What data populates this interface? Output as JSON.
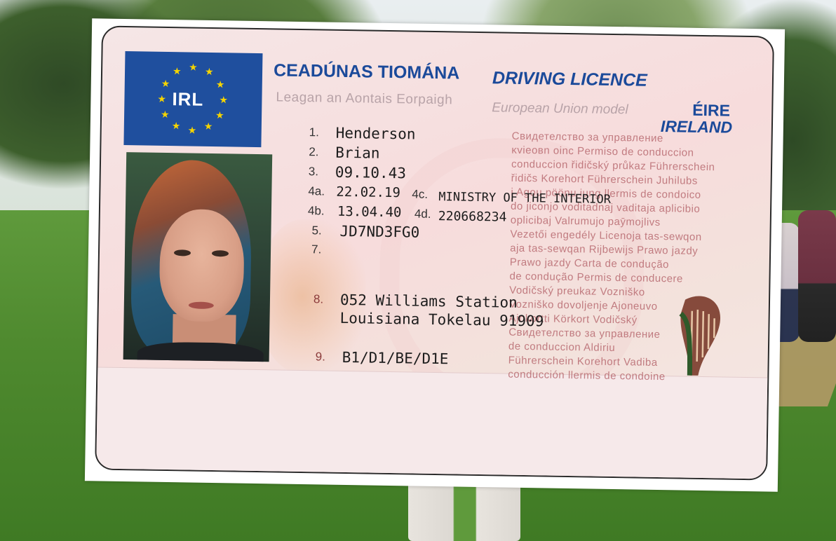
{
  "card": {
    "flag_code": "IRL",
    "title_ga": "CEADÚNAS TIOMÁNA",
    "title_en": "DRIVING LICENCE",
    "country_ga": "ÉIRE",
    "country_en": "IRELAND",
    "model_ga": "Leagan an Aontais Eorpaigh",
    "model_en": "European Union model"
  },
  "fields": {
    "f1": {
      "num": "1.",
      "value": "Henderson"
    },
    "f2": {
      "num": "2.",
      "value": "Brian"
    },
    "f3": {
      "num": "3.",
      "value": "09.10.43"
    },
    "f4a": {
      "num": "4a.",
      "value": "22.02.19"
    },
    "f4c": {
      "num": "4c.",
      "value": "MINISTRY OF THE INTERIOR"
    },
    "f4b": {
      "num": "4b.",
      "value": "13.04.40"
    },
    "f4d": {
      "num": "4d.",
      "value": "220668234"
    },
    "f5": {
      "num": "5.",
      "value": "JD7ND3FG0"
    },
    "f7": {
      "num": "7.",
      "value": ""
    },
    "f8": {
      "num": "8.",
      "line1": "052 Williams Station",
      "line2": "Louisiana Tokelau 91909"
    },
    "f9": {
      "num": "9.",
      "value": "B1/D1/BE/D1E"
    }
  },
  "microtext": [
    "Свидетелство за управление",
    "ĸvieoвn oinc Permiso de conduccion",
    "conduccion řidičský průkaz Führerschein",
    "řidičs Korehort Führerschein Juhilubs",
    "i Agou pöönu iung llermis de condoico",
    "do jiconjo voditadnaj vaditaja aplicibio",
    "oplicibaj Valrumujo paȳmojlivs",
    "Vezetői engedély Licenoja tas-sewqon",
    "aja tas-sewqan Rijbewijs Prawo jazdy",
    "Prawo jazdy Carta de condução",
    "de condução Permis de conducere",
    "Vodičský preukaz Vozniško",
    "Vozniško dovoljenje Ajoneuvo",
    "Ajokortti Körkort Vodičský",
    "Свидетелство за управление",
    "de conduccion Aldiriu",
    "Führerschein Korehort Vadiba",
    "conducción llermis de condoine"
  ],
  "colors": {
    "brand_blue": "#1b4a9a",
    "flag_blue": "#1f4f9e",
    "star_yellow": "#f5d400",
    "card_pink": "#f7dcdc"
  }
}
